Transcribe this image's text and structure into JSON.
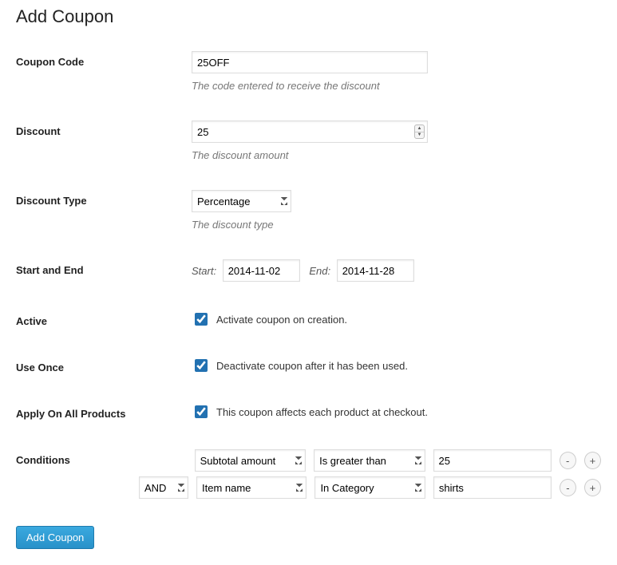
{
  "title": "Add Coupon",
  "labels": {
    "coupon_code": "Coupon Code",
    "discount": "Discount",
    "discount_type": "Discount Type",
    "start_end": "Start and End",
    "active": "Active",
    "use_once": "Use Once",
    "apply_all": "Apply On All Products",
    "conditions": "Conditions",
    "start": "Start:",
    "end": "End:"
  },
  "hints": {
    "coupon_code": "The code entered to receive the discount",
    "discount": "The discount amount",
    "discount_type": "The discount type"
  },
  "values": {
    "coupon_code": "25OFF",
    "discount": "25",
    "discount_type": "Percentage",
    "start_date": "2014-11-02",
    "end_date": "2014-11-28"
  },
  "checkboxes": {
    "active": {
      "checked": true,
      "label": "Activate coupon on creation."
    },
    "use_once": {
      "checked": true,
      "label": "Deactivate coupon after it has been used."
    },
    "apply_all": {
      "checked": true,
      "label": "This coupon affects each product at checkout."
    }
  },
  "conditions": [
    {
      "join": "",
      "left": "Subtotal amount",
      "op": "Is greater than",
      "value": "25"
    },
    {
      "join": "AND",
      "left": "Item name",
      "op": "In Category",
      "value": "shirts"
    }
  ],
  "buttons": {
    "remove": "-",
    "add": "+",
    "submit": "Add Coupon"
  }
}
